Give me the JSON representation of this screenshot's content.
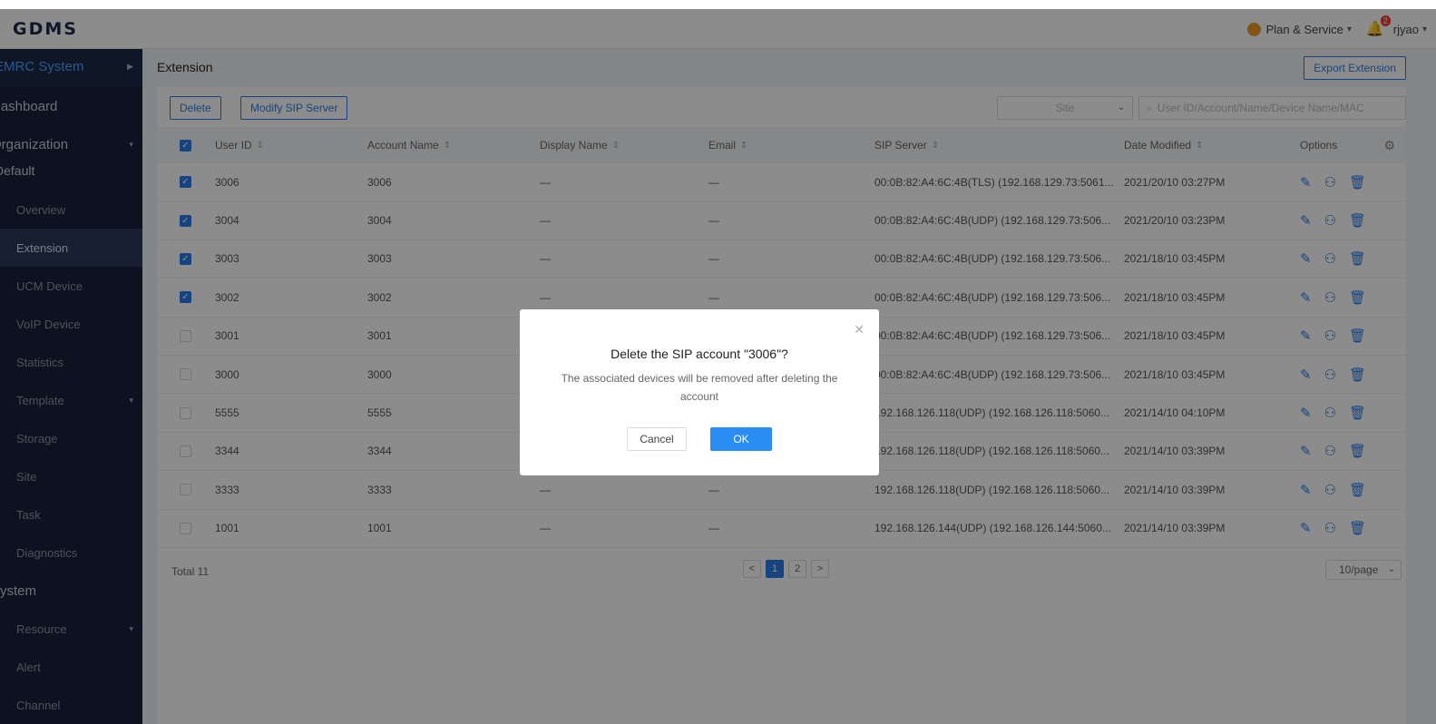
{
  "app": {
    "logo": "GDMS"
  },
  "topbar": {
    "plan_label": "Plan & Service",
    "notification_count": "2",
    "user": "rjyao"
  },
  "sidebar": {
    "header": "EMRC System",
    "items": [
      {
        "label": "Dashboard",
        "level": "lvl1"
      },
      {
        "label": "Organization",
        "level": "lvl1",
        "arrow": "▾"
      },
      {
        "label": "Default",
        "level": "lvl1b"
      },
      {
        "label": "Overview",
        "level": "lvl2"
      },
      {
        "label": "Extension",
        "level": "lvl2",
        "active": true
      },
      {
        "label": "UCM Device",
        "level": "lvl2"
      },
      {
        "label": "VoIP Device",
        "level": "lvl2"
      },
      {
        "label": "Statistics",
        "level": "lvl2"
      },
      {
        "label": "Template",
        "level": "lvl2",
        "arrow": "▾"
      },
      {
        "label": "Storage",
        "level": "lvl2"
      },
      {
        "label": "Site",
        "level": "lvl2"
      },
      {
        "label": "Task",
        "level": "lvl2"
      },
      {
        "label": "Diagnostics",
        "level": "lvl2"
      },
      {
        "label": "System",
        "level": "lvl1"
      },
      {
        "label": "Resource",
        "level": "lvl2",
        "arrow": "▾"
      },
      {
        "label": "Alert",
        "level": "lvl2"
      },
      {
        "label": "Channel",
        "level": "lvl2"
      }
    ]
  },
  "page": {
    "title": "Extension",
    "export_label": "Export Extension"
  },
  "toolbar": {
    "delete_label": "Delete",
    "modify_label": "Modify SIP Server",
    "site_placeholder": "Site",
    "search_placeholder": "User ID/Account/Name/Device Name/MAC"
  },
  "table": {
    "headers": [
      "User ID",
      "Account Name",
      "Display Name",
      "Email",
      "SIP Server",
      "Date Modified",
      "Options"
    ],
    "rows": [
      {
        "checked": true,
        "user_id": "3006",
        "account": "3006",
        "display": "—",
        "email": "—",
        "sip": "00:0B:82:A4:6C:4B(TLS) (192.168.129.73:5061...",
        "date": "2021/20/10 03:27PM"
      },
      {
        "checked": true,
        "user_id": "3004",
        "account": "3004",
        "display": "—",
        "email": "—",
        "sip": "00:0B:82:A4:6C:4B(UDP) (192.168.129.73:506...",
        "date": "2021/20/10 03:23PM"
      },
      {
        "checked": true,
        "user_id": "3003",
        "account": "3003",
        "display": "—",
        "email": "—",
        "sip": "00:0B:82:A4:6C:4B(UDP) (192.168.129.73:506...",
        "date": "2021/18/10 03:45PM"
      },
      {
        "checked": true,
        "user_id": "3002",
        "account": "3002",
        "display": "—",
        "email": "—",
        "sip": "00:0B:82:A4:6C:4B(UDP) (192.168.129.73:506...",
        "date": "2021/18/10 03:45PM"
      },
      {
        "checked": false,
        "user_id": "3001",
        "account": "3001",
        "display": "—",
        "email": "—",
        "sip": "00:0B:82:A4:6C:4B(UDP) (192.168.129.73:506...",
        "date": "2021/18/10 03:45PM"
      },
      {
        "checked": false,
        "user_id": "3000",
        "account": "3000",
        "display": "—",
        "email": "—",
        "sip": "00:0B:82:A4:6C:4B(UDP) (192.168.129.73:506...",
        "date": "2021/18/10 03:45PM"
      },
      {
        "checked": false,
        "user_id": "5555",
        "account": "5555",
        "display": "—",
        "email": "—",
        "sip": "192.168.126.118(UDP) (192.168.126.118:5060...",
        "date": "2021/14/10 04:10PM"
      },
      {
        "checked": false,
        "user_id": "3344",
        "account": "3344",
        "display": "—",
        "email": "—",
        "sip": "192.168.126.118(UDP) (192.168.126.118:5060...",
        "date": "2021/14/10 03:39PM"
      },
      {
        "checked": false,
        "user_id": "3333",
        "account": "3333",
        "display": "—",
        "email": "—",
        "sip": "192.168.126.118(UDP) (192.168.126.118:5060...",
        "date": "2021/14/10 03:39PM"
      },
      {
        "checked": false,
        "user_id": "1001",
        "account": "1001",
        "display": "—",
        "email": "—",
        "sip": "192.168.126.144(UDP) (192.168.126.144:5060...",
        "date": "2021/14/10 03:39PM"
      }
    ]
  },
  "footer": {
    "total": "Total 11",
    "pages": [
      "1",
      "2"
    ],
    "current_page": "1",
    "per_page": "10/page"
  },
  "modal": {
    "title": "Delete the SIP account \"3006\"?",
    "message": "The associated devices will be removed after deleting the account",
    "cancel_label": "Cancel",
    "ok_label": "OK"
  },
  "colors": {
    "accent": "#2b7de9",
    "sidebar_bg": "#16213a",
    "ok_button": "#2b8cf5"
  }
}
